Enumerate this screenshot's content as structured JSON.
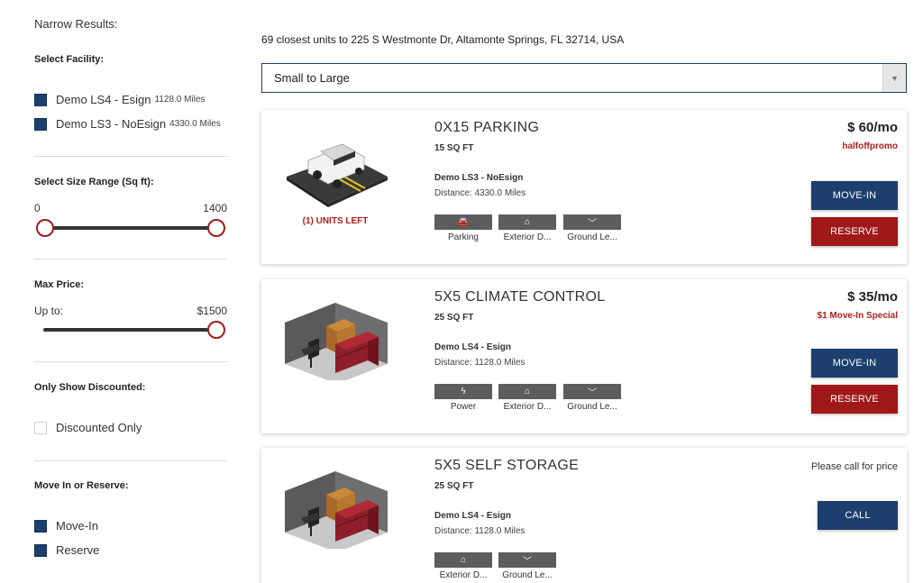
{
  "sidebar": {
    "narrow_title": "Narrow Results:",
    "facility": {
      "title": "Select Facility:",
      "options": [
        {
          "name": "Demo LS4 - Esign",
          "distance": "1128.0 Miles",
          "checked": true
        },
        {
          "name": "Demo LS3 - NoEsign",
          "distance": "4330.0 Miles",
          "checked": true
        }
      ]
    },
    "size": {
      "title": "Select Size Range (Sq ft):",
      "min": "0",
      "max": "1400"
    },
    "price": {
      "title": "Max Price:",
      "label": "Up to:",
      "value": "$1500"
    },
    "discounted": {
      "title": "Only Show Discounted:",
      "option": "Discounted Only",
      "checked": false
    },
    "move": {
      "title": "Move In or Reserve:",
      "options": [
        {
          "name": "Move-In",
          "checked": true
        },
        {
          "name": "Reserve",
          "checked": true
        }
      ]
    }
  },
  "main": {
    "header": "69 closest units to 225 S Westmonte Dr, Altamonte Springs, FL 32714, USA",
    "sort": "Small to Large",
    "units": [
      {
        "title": "0X15 PARKING",
        "sqft": "15 SQ FT",
        "facility": "Demo LS3 - NoEsign",
        "distance": "Distance: 4330.0 Miles",
        "units_left": "(1) UNITS LEFT",
        "price": "$ 60/mo",
        "promo": "halfoffpromo",
        "amenities": [
          {
            "icon": "parking-icon",
            "label": "Parking"
          },
          {
            "icon": "house-icon",
            "label": "Exterior D..."
          },
          {
            "icon": "chevron-down-icon",
            "label": "Ground Le..."
          }
        ],
        "move_in": "MOVE-IN",
        "reserve": "RESERVE"
      },
      {
        "title": "5X5 CLIMATE CONTROL",
        "sqft": "25 SQ FT",
        "facility": "Demo LS4 - Esign",
        "distance": "Distance: 1128.0 Miles",
        "price": "$ 35/mo",
        "promo": "$1 Move-In Special",
        "amenities": [
          {
            "icon": "lightning-icon",
            "label": "Power"
          },
          {
            "icon": "house-icon",
            "label": "Exterior D..."
          },
          {
            "icon": "chevron-down-icon",
            "label": "Ground Le..."
          }
        ],
        "move_in": "MOVE-IN",
        "reserve": "RESERVE"
      },
      {
        "title": "5X5 SELF STORAGE",
        "sqft": "25 SQ FT",
        "facility": "Demo LS4 - Esign",
        "distance": "Distance: 1128.0 Miles",
        "call_price": "Please call for price",
        "amenities": [
          {
            "icon": "house-icon",
            "label": "Exterior D..."
          },
          {
            "icon": "chevron-down-icon",
            "label": "Ground Le..."
          }
        ],
        "call": "CALL"
      }
    ]
  },
  "colors": {
    "primary": "#1c3f6e",
    "accent": "#a11818",
    "promo": "#b01e1e"
  }
}
